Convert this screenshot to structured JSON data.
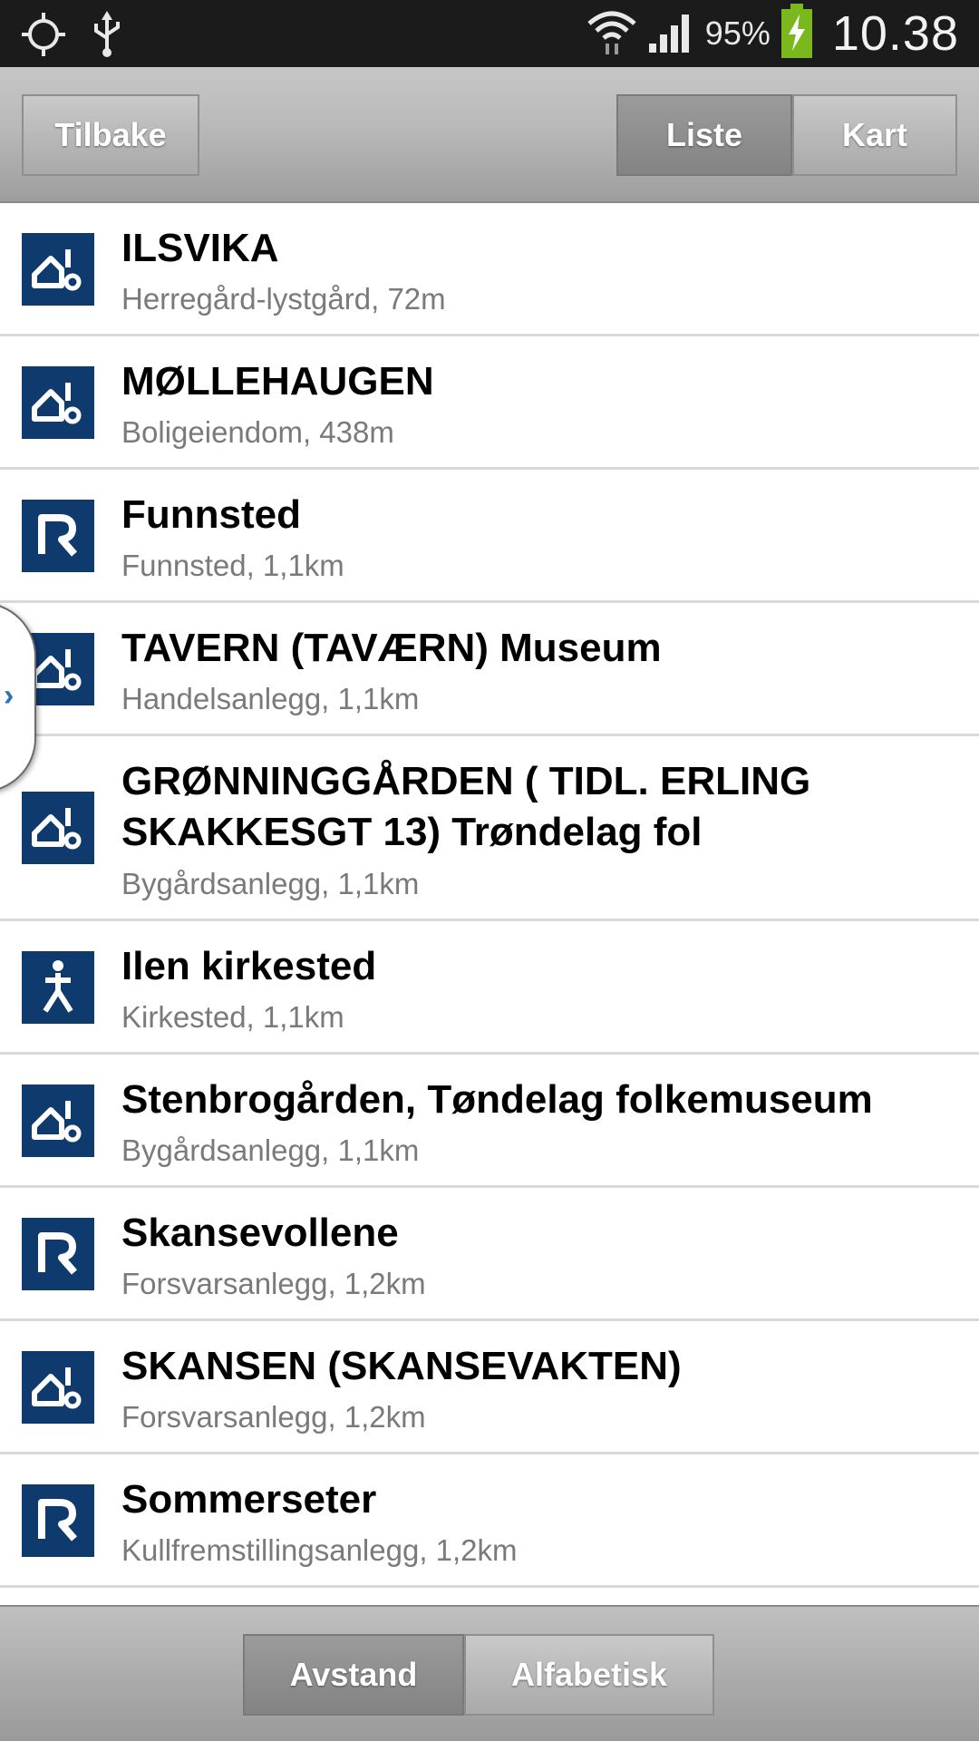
{
  "status_bar": {
    "battery_percent": "95%",
    "time": "10.38",
    "icons": [
      "gps-icon",
      "usb-icon",
      "wifi-icon",
      "signal-icon",
      "battery-charging-icon"
    ]
  },
  "top_bar": {
    "back_label": "Tilbake",
    "tabs": [
      {
        "label": "Liste",
        "active": true
      },
      {
        "label": "Kart",
        "active": false
      }
    ]
  },
  "list": {
    "items": [
      {
        "title": "ILSVIKA",
        "subtitle": "Herregård-lystgård, 72m",
        "icon": "building-icon"
      },
      {
        "title": "MØLLEHAUGEN",
        "subtitle": "Boligeiendom, 438m",
        "icon": "building-icon"
      },
      {
        "title": "Funnsted",
        "subtitle": "Funnsted, 1,1km",
        "icon": "r-mark-icon"
      },
      {
        "title": "TAVERN (TAVÆRN) Museum",
        "subtitle": "Handelsanlegg, 1,1km",
        "icon": "building-icon"
      },
      {
        "title": "GRØNNINGGÅRDEN ( TIDL. ERLING SKAKKESGT 13) Trøndelag fol",
        "subtitle": "Bygårdsanlegg, 1,1km",
        "icon": "building-icon"
      },
      {
        "title": "Ilen kirkested",
        "subtitle": "Kirkested, 1,1km",
        "icon": "church-site-icon"
      },
      {
        "title": "Stenbrogården, Tøndelag folkemuseum",
        "subtitle": "Bygårdsanlegg, 1,1km",
        "icon": "building-icon"
      },
      {
        "title": "Skansevollene",
        "subtitle": "Forsvarsanlegg, 1,2km",
        "icon": "r-mark-icon"
      },
      {
        "title": "SKANSEN (SKANSEVAKTEN)",
        "subtitle": "Forsvarsanlegg, 1,2km",
        "icon": "building-icon"
      },
      {
        "title": "Sommerseter",
        "subtitle": "Kullfremstillingsanlegg, 1,2km",
        "icon": "r-mark-icon"
      }
    ]
  },
  "bottom_bar": {
    "sort_options": [
      {
        "label": "Avstand",
        "active": true
      },
      {
        "label": "Alfabetisk",
        "active": false
      }
    ]
  },
  "colors": {
    "icon_bg": "#0f3a6e",
    "status_bar_bg": "#1b1b1b",
    "battery_green": "#7ab81e",
    "subtitle_gray": "#7a7a7a"
  }
}
